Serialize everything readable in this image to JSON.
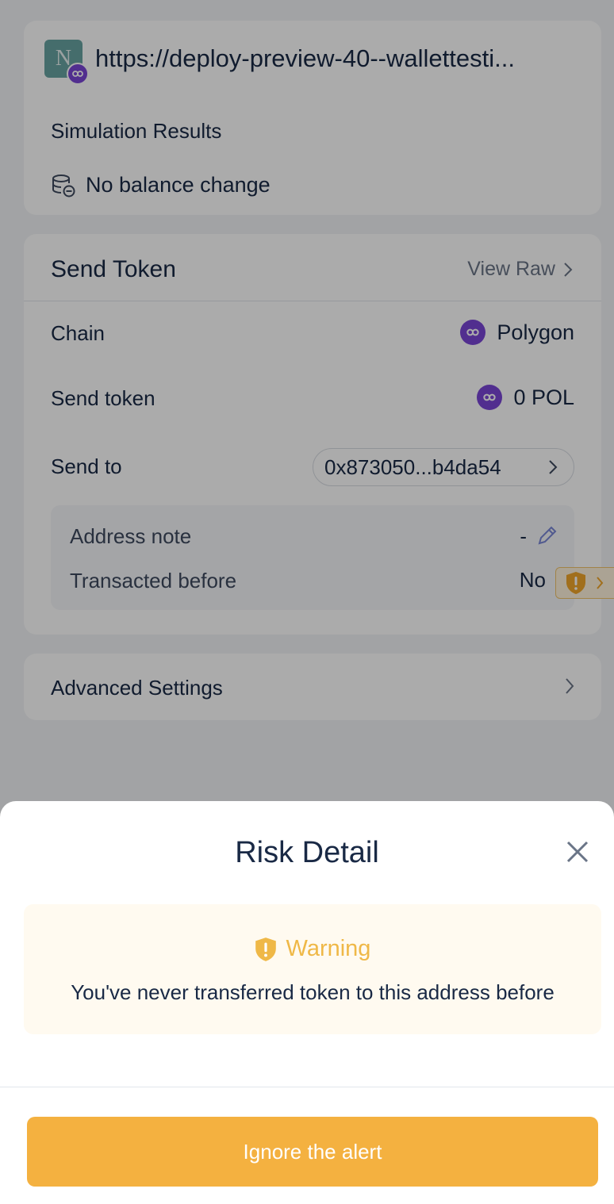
{
  "site": {
    "logo_letter": "N",
    "url": "https://deploy-preview-40--wallettesti..."
  },
  "simulation": {
    "title": "Simulation Results",
    "balance_text": "No balance change"
  },
  "send_token": {
    "title": "Send Token",
    "view_raw": "View Raw",
    "chain_label": "Chain",
    "chain_value": "Polygon",
    "token_label": "Send token",
    "token_value": "0 POL",
    "to_label": "Send to",
    "to_address": "0x873050...b4da54",
    "address_note_label": "Address note",
    "address_note_value": "-",
    "transacted_label": "Transacted before",
    "transacted_value": "No"
  },
  "advanced": {
    "label": "Advanced Settings"
  },
  "risk_sheet": {
    "title": "Risk Detail",
    "warning_title": "Warning",
    "warning_message": "You've never transferred token to this address before",
    "ignore_button": "Ignore the alert"
  },
  "colors": {
    "polygon": "#7a45d6",
    "warning": "#efb847",
    "button": "#f4b140",
    "text": "#192945"
  }
}
